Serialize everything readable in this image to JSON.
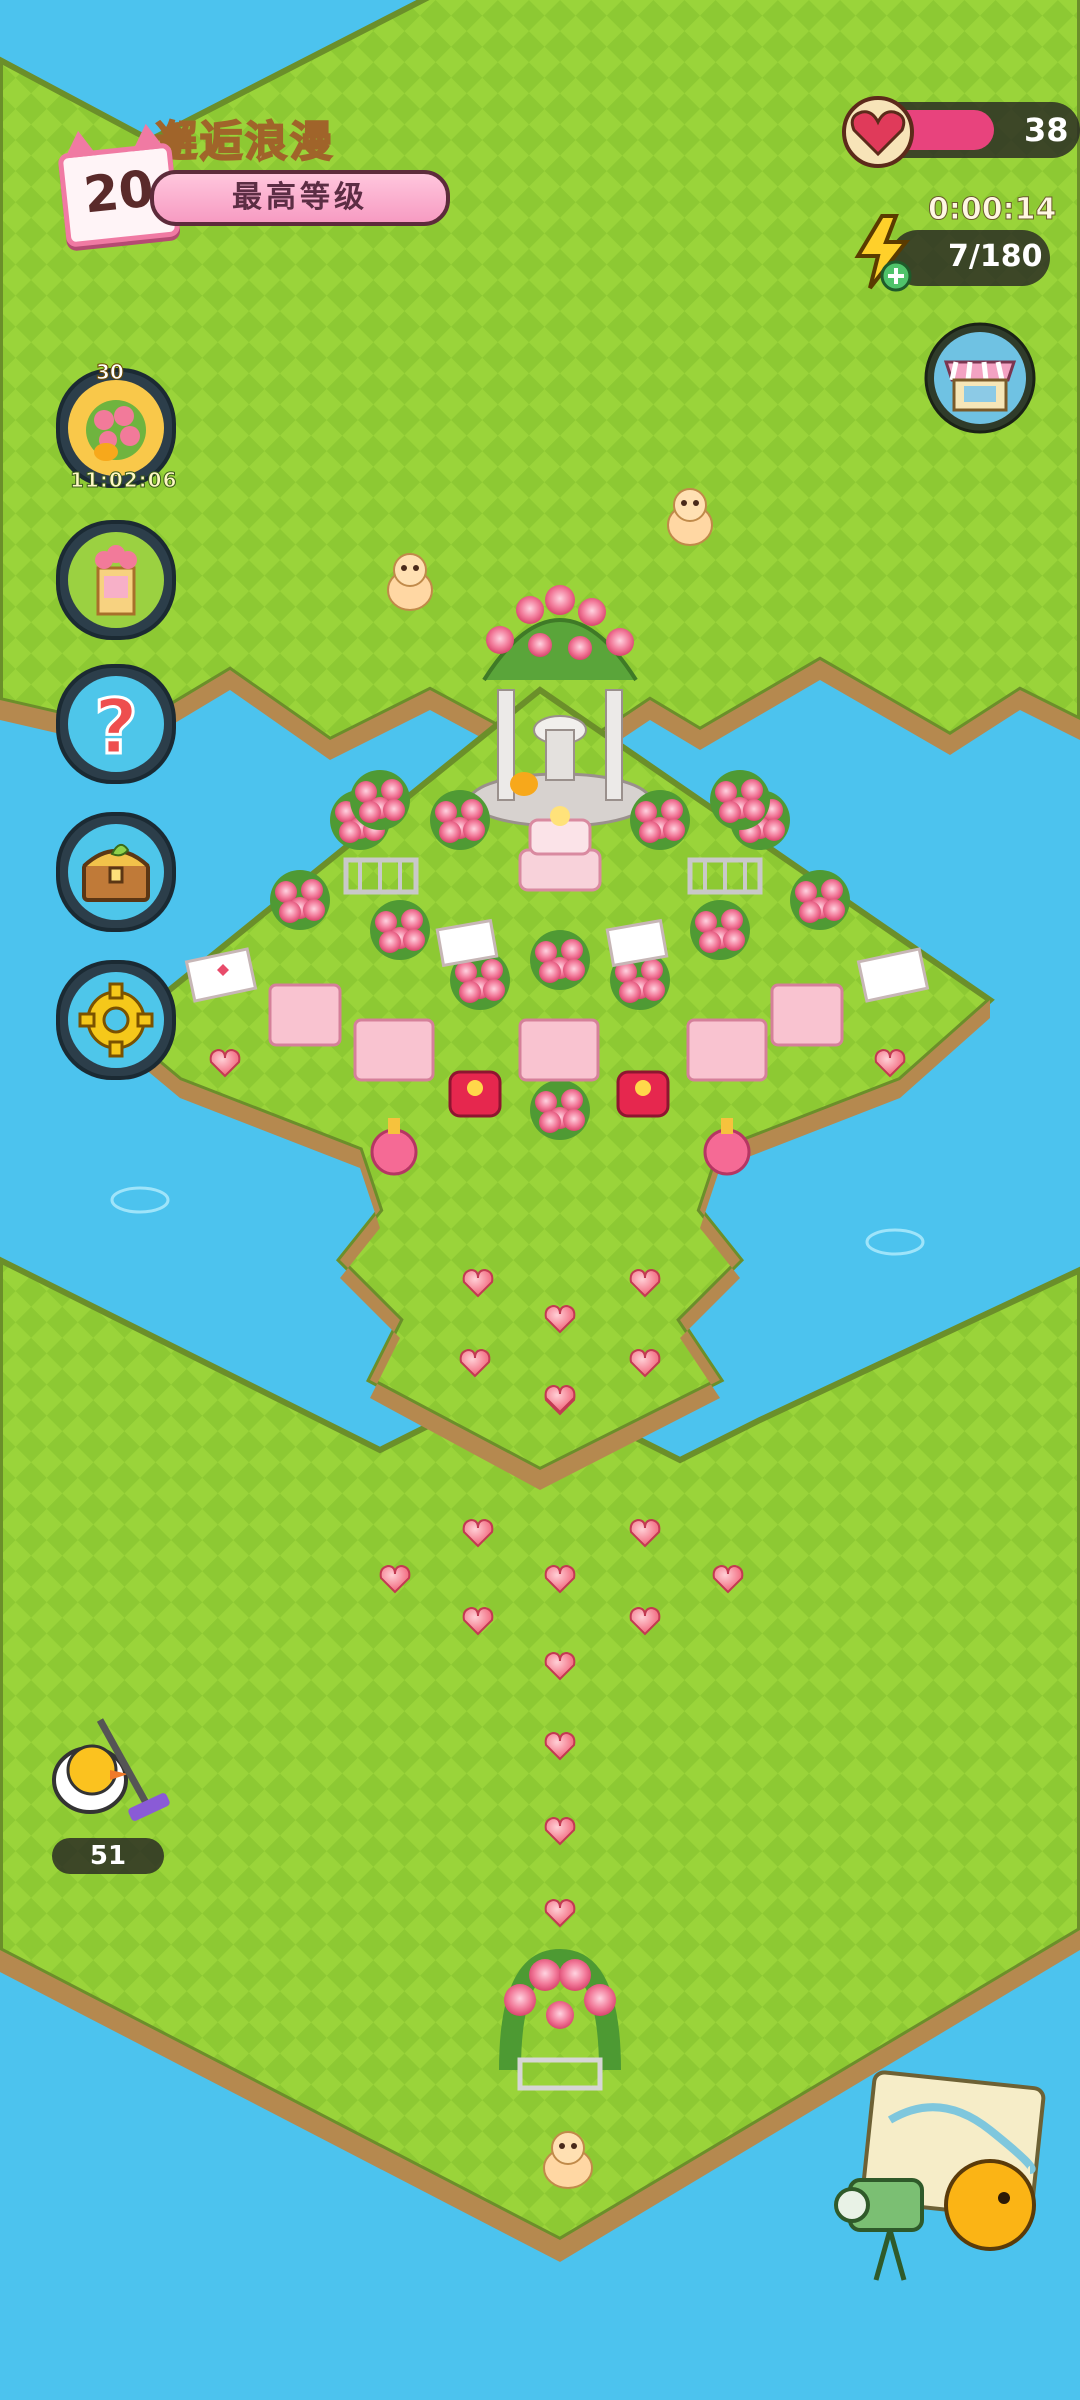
{
  "level": {
    "title": "邂逅浪漫",
    "number": "20",
    "status": "最高等级"
  },
  "resources": {
    "hearts": "38",
    "energy_timer": "0:00:14",
    "energy": "7/180",
    "heart_fill_fraction": 0.6
  },
  "event": {
    "badge": "30",
    "timer": "11:02:06"
  },
  "cleaner": {
    "count": "51"
  },
  "colors": {
    "water": "#4cc3ee",
    "grass_light": "#9ad43a",
    "grass_dark": "#86c22f",
    "rose": "#f27a9a",
    "accent_pink": "#e8437d"
  },
  "icons": {
    "heart": "heart-icon",
    "energy": "lightning-plus-icon",
    "shop": "shop-stall-icon",
    "help": "question-icon",
    "chest": "treasure-chest-icon",
    "settings": "gear-icon",
    "camera": "camera-map-icon",
    "cleaner": "vacuum-chick-icon"
  }
}
